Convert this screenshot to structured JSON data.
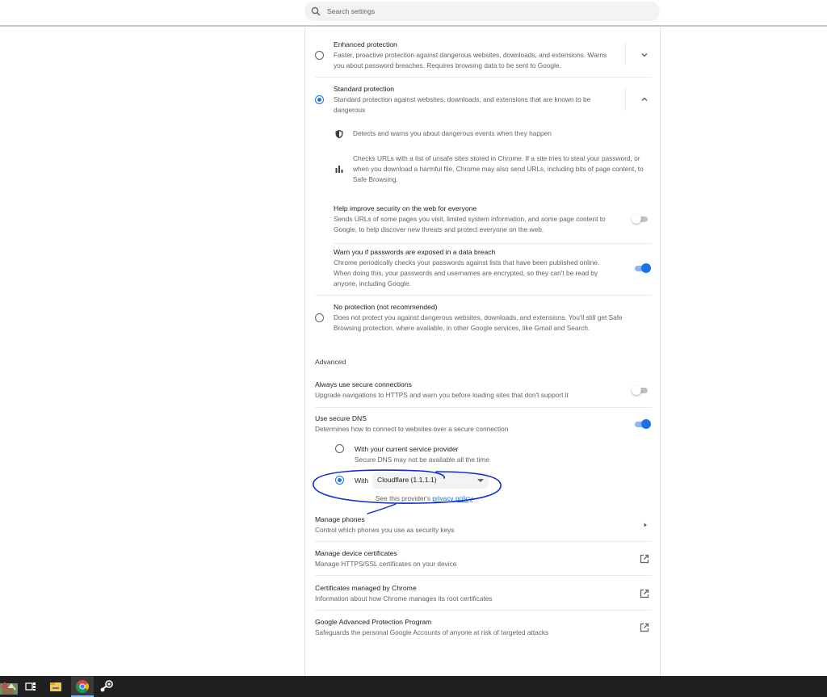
{
  "search": {
    "placeholder": "Search settings",
    "icon": "search-icon"
  },
  "safe_browsing": {
    "enhanced": {
      "title": "Enhanced protection",
      "desc": "Faster, proactive protection against dangerous websites, downloads, and extensions. Warns you about password breaches. Requires browsing data to be sent to Google.",
      "selected": false
    },
    "standard": {
      "title": "Standard protection",
      "desc": "Standard protection against websites, downloads, and extensions that are known to be dangerous",
      "selected": true,
      "details": [
        {
          "icon": "shield-icon",
          "text": "Detects and warns you about dangerous events when they happen"
        },
        {
          "icon": "bar-chart-icon",
          "text": "Checks URLs with a list of unsafe sites stored in Chrome. If a site tries to steal your password, or when you download a harmful file, Chrome may also send URLs, including bits of page content, to Safe Browsing."
        }
      ],
      "help_improve": {
        "title": "Help improve security on the web for everyone",
        "desc": "Sends URLs of some pages you visit, limited system information, and some page content to Google, to help discover new threats and protect everyone on the web.",
        "enabled": false
      },
      "password_warn": {
        "title": "Warn you if passwords are exposed in a data breach",
        "desc": "Chrome periodically checks your passwords against lists that have been published online. When doing this, your passwords and usernames are encrypted, so they can't be read by anyone, including Google.",
        "enabled": true
      }
    },
    "none": {
      "title": "No protection (not recommended)",
      "desc": "Does not protect you against dangerous websites, downloads, and extensions. You'll still get Safe Browsing protection, where available, in other Google services, like Gmail and Search.",
      "selected": false
    }
  },
  "advanced": {
    "heading": "Advanced",
    "https": {
      "title": "Always use secure connections",
      "desc": "Upgrade navigations to HTTPS and warn you before loading sites that don't support it",
      "enabled": false
    },
    "dns": {
      "title": "Use secure DNS",
      "desc": "Determines how to connect to websites over a secure connection",
      "enabled": true,
      "current_provider": {
        "title": "With your current service provider",
        "desc": "Secure DNS may not be available all the time",
        "selected": false
      },
      "custom": {
        "label": "With",
        "selected": true,
        "provider": "Cloudflare (1.1.1.1)",
        "policy_prefix": "See this provider's ",
        "policy_link": "privacy policy"
      }
    },
    "phones": {
      "title": "Manage phones",
      "desc": "Control which phones you use as security keys"
    },
    "certs": {
      "title": "Manage device certificates",
      "desc": "Manage HTTPS/SSL certificates on your device"
    },
    "chrome_certs": {
      "title": "Certificates managed by Chrome",
      "desc": "Information about how Chrome manages its root certificates"
    },
    "gapp": {
      "title": "Google Advanced Protection Program",
      "desc": "Safeguards the personal Google Accounts of anyone at risk of targeted attacks"
    }
  },
  "colors": {
    "accent": "#1a73e8",
    "annotation": "#0a2bd6",
    "taskbar": "#202020"
  },
  "taskbar": {
    "apps": [
      "widgets-icon",
      "task-view-icon",
      "file-explorer-icon",
      "chrome-icon",
      "steam-icon"
    ]
  }
}
